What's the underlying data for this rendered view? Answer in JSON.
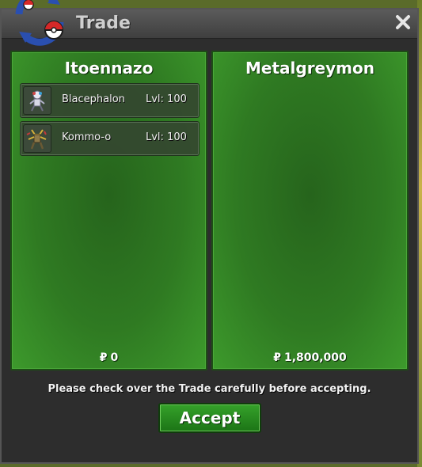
{
  "window": {
    "title": "Trade",
    "close_icon": "close-x-icon"
  },
  "left_panel": {
    "trainer": "Itoennazo",
    "pokemon": [
      {
        "name": "Blacephalon",
        "level": "Lvl: 100",
        "icon": "blacephalon-sprite"
      },
      {
        "name": "Kommo-o",
        "level": "Lvl: 100",
        "icon": "kommo-o-sprite"
      }
    ],
    "money_symbol": "₽",
    "money": "0"
  },
  "right_panel": {
    "trainer": "Metalgreymon",
    "pokemon": [],
    "money_symbol": "₽",
    "money": "1,800,000"
  },
  "notice": "Please check over the Trade carefully before accepting.",
  "accept_label": "Accept",
  "colors": {
    "panel_green": "#2f7a22",
    "accept_green": "#2a8c20",
    "window_bg": "#2d2d2d"
  }
}
